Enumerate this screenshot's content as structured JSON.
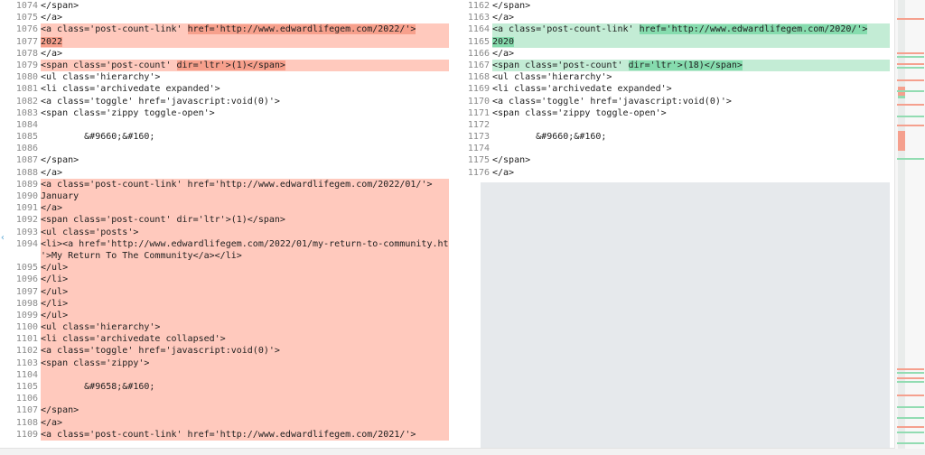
{
  "left": [
    {
      "n": "1074",
      "parts": [
        {
          "t": "</span>"
        }
      ],
      "type": "ctx"
    },
    {
      "n": "1075",
      "parts": [
        {
          "t": "</a>"
        }
      ],
      "type": "ctx"
    },
    {
      "n": "1076",
      "parts": [
        {
          "t": "<a class='post-count-link' "
        },
        {
          "t": "href='http://www.edwardlifegem.com/2022/'>",
          "hl": true
        }
      ],
      "type": "del"
    },
    {
      "n": "1077",
      "parts": [
        {
          "t": "2022",
          "hl": true
        }
      ],
      "type": "del"
    },
    {
      "n": "1078",
      "parts": [
        {
          "t": "</a>"
        }
      ],
      "type": "ctx"
    },
    {
      "n": "1079",
      "parts": [
        {
          "t": "<span class='post-count' "
        },
        {
          "t": "dir='ltr'>(1)</span>",
          "hl": true
        }
      ],
      "type": "del"
    },
    {
      "n": "1080",
      "parts": [
        {
          "t": "<ul class='hierarchy'>"
        }
      ],
      "type": "ctx"
    },
    {
      "n": "1081",
      "parts": [
        {
          "t": "<li class='archivedate expanded'>"
        }
      ],
      "type": "ctx"
    },
    {
      "n": "1082",
      "parts": [
        {
          "t": "<a class='toggle' href='javascript:void(0)'>"
        }
      ],
      "type": "ctx"
    },
    {
      "n": "1083",
      "parts": [
        {
          "t": "<span class='zippy toggle-open'>"
        }
      ],
      "type": "ctx"
    },
    {
      "n": "1084",
      "parts": [
        {
          "t": ""
        }
      ],
      "type": "ctx"
    },
    {
      "n": "1085",
      "parts": [
        {
          "t": "        &#9660;&#160;"
        }
      ],
      "type": "ctx"
    },
    {
      "n": "1086",
      "parts": [
        {
          "t": ""
        }
      ],
      "type": "ctx"
    },
    {
      "n": "1087",
      "parts": [
        {
          "t": "</span>"
        }
      ],
      "type": "ctx"
    },
    {
      "n": "1088",
      "parts": [
        {
          "t": "</a>"
        }
      ],
      "type": "ctx"
    },
    {
      "n": "1089",
      "parts": [
        {
          "t": "<a class='post-count-link' href='http://www.edwardlifegem.com/2022/01/'>"
        }
      ],
      "type": "del"
    },
    {
      "n": "1090",
      "parts": [
        {
          "t": "January"
        }
      ],
      "type": "del"
    },
    {
      "n": "1091",
      "parts": [
        {
          "t": "</a>"
        }
      ],
      "type": "del"
    },
    {
      "n": "1092",
      "parts": [
        {
          "t": "<span class='post-count' dir='ltr'>(1)</span>"
        }
      ],
      "type": "del"
    },
    {
      "n": "1093",
      "parts": [
        {
          "t": "<ul class='posts'>"
        }
      ],
      "type": "del"
    },
    {
      "n": "1094",
      "parts": [
        {
          "t": "<li><a href='http://www.edwardlifegem.com/2022/01/my-return-to-community.html"
        }
      ],
      "type": "del"
    },
    {
      "n": "",
      "parts": [
        {
          "t": "'>My Return To The Community</a></li>"
        }
      ],
      "type": "del"
    },
    {
      "n": "1095",
      "parts": [
        {
          "t": "</ul>"
        }
      ],
      "type": "del"
    },
    {
      "n": "1096",
      "parts": [
        {
          "t": "</li>"
        }
      ],
      "type": "del"
    },
    {
      "n": "1097",
      "parts": [
        {
          "t": "</ul>"
        }
      ],
      "type": "del"
    },
    {
      "n": "1098",
      "parts": [
        {
          "t": "</li>"
        }
      ],
      "type": "del"
    },
    {
      "n": "1099",
      "parts": [
        {
          "t": "</ul>"
        }
      ],
      "type": "del"
    },
    {
      "n": "1100",
      "parts": [
        {
          "t": "<ul class='hierarchy'>"
        }
      ],
      "type": "del"
    },
    {
      "n": "1101",
      "parts": [
        {
          "t": "<li class='archivedate collapsed'>"
        }
      ],
      "type": "del"
    },
    {
      "n": "1102",
      "parts": [
        {
          "t": "<a class='toggle' href='javascript:void(0)'>"
        }
      ],
      "type": "del"
    },
    {
      "n": "1103",
      "parts": [
        {
          "t": "<span class='zippy'>"
        }
      ],
      "type": "del"
    },
    {
      "n": "1104",
      "parts": [
        {
          "t": ""
        }
      ],
      "type": "del"
    },
    {
      "n": "1105",
      "parts": [
        {
          "t": "        &#9658;&#160;"
        }
      ],
      "type": "del"
    },
    {
      "n": "1106",
      "parts": [
        {
          "t": ""
        }
      ],
      "type": "del"
    },
    {
      "n": "1107",
      "parts": [
        {
          "t": "</span>"
        }
      ],
      "type": "del"
    },
    {
      "n": "1108",
      "parts": [
        {
          "t": "</a>"
        }
      ],
      "type": "del"
    },
    {
      "n": "1109",
      "parts": [
        {
          "t": "<a class='post-count-link' href='http://www.edwardlifegem.com/2021/'>"
        }
      ],
      "type": "del"
    }
  ],
  "right": [
    {
      "n": "1162",
      "parts": [
        {
          "t": "</span>"
        }
      ],
      "type": "ctx"
    },
    {
      "n": "1163",
      "parts": [
        {
          "t": "</a>"
        }
      ],
      "type": "ctx"
    },
    {
      "n": "1164",
      "parts": [
        {
          "t": "<a class='post-count-link' "
        },
        {
          "t": "href='http://www.edwardlifegem.com/2020/'>",
          "hl": true
        }
      ],
      "type": "add"
    },
    {
      "n": "1165",
      "parts": [
        {
          "t": "2020",
          "hl": true
        }
      ],
      "type": "add"
    },
    {
      "n": "1166",
      "parts": [
        {
          "t": "</a>"
        }
      ],
      "type": "ctx"
    },
    {
      "n": "1167",
      "parts": [
        {
          "t": "<span class='post-count' "
        },
        {
          "t": "dir='ltr'>(18)</span>",
          "hl": true
        }
      ],
      "type": "add"
    },
    {
      "n": "1168",
      "parts": [
        {
          "t": "<ul class='hierarchy'>"
        }
      ],
      "type": "ctx"
    },
    {
      "n": "1169",
      "parts": [
        {
          "t": "<li class='archivedate expanded'>"
        }
      ],
      "type": "ctx"
    },
    {
      "n": "1170",
      "parts": [
        {
          "t": "<a class='toggle' href='javascript:void(0)'>"
        }
      ],
      "type": "ctx"
    },
    {
      "n": "1171",
      "parts": [
        {
          "t": "<span class='zippy toggle-open'>"
        }
      ],
      "type": "ctx"
    },
    {
      "n": "1172",
      "parts": [
        {
          "t": ""
        }
      ],
      "type": "ctx"
    },
    {
      "n": "1173",
      "parts": [
        {
          "t": "        &#9660;&#160;"
        }
      ],
      "type": "ctx"
    },
    {
      "n": "1174",
      "parts": [
        {
          "t": ""
        }
      ],
      "type": "ctx"
    },
    {
      "n": "1175",
      "parts": [
        {
          "t": "</span>"
        }
      ],
      "type": "ctx"
    },
    {
      "n": "1176",
      "parts": [
        {
          "t": "</a>"
        }
      ],
      "type": "ctx"
    }
  ],
  "colors": {
    "deleted_line": "#ffc9bd",
    "deleted_highlight": "#f7a08c",
    "added_line": "#c3ecd5",
    "added_highlight": "#86dcae",
    "empty_region": "#e6e9ec"
  },
  "icons": {
    "gutter": "revert-arrow-icon"
  }
}
